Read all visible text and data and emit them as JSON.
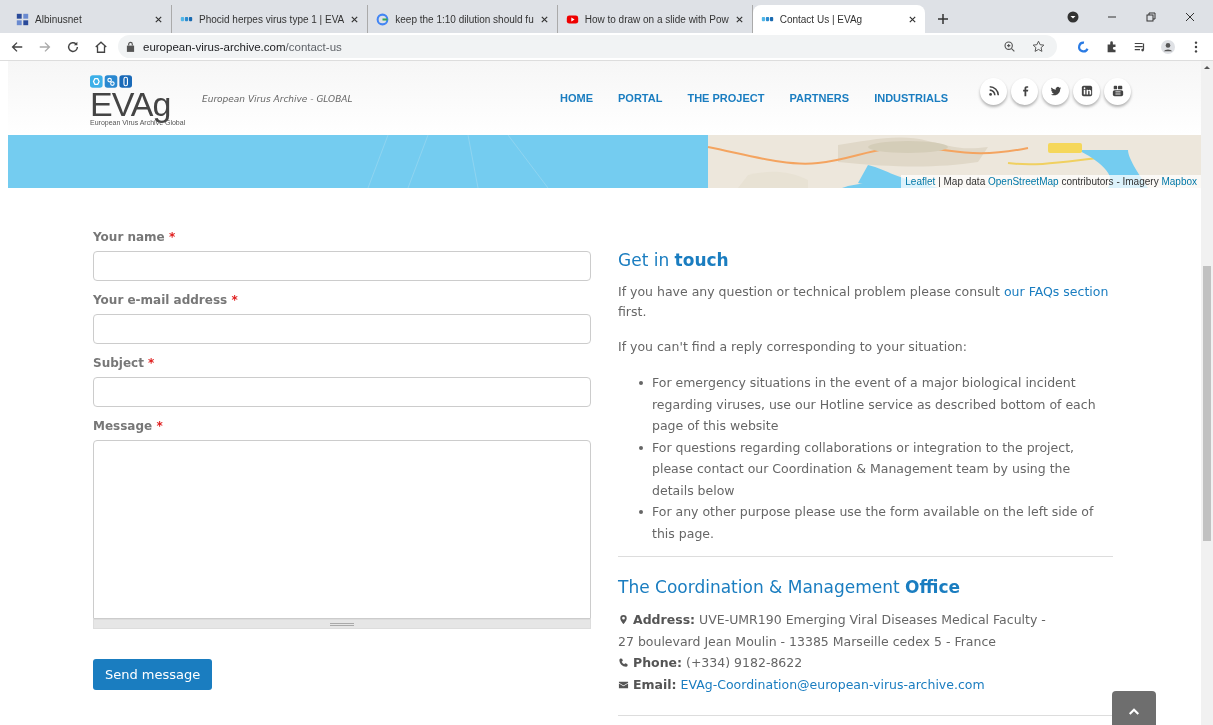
{
  "browser": {
    "tabs": [
      {
        "title": "Albinusnet",
        "kind": "lumc",
        "selected": false
      },
      {
        "title": "Phocid herpes virus type 1 | EVA",
        "kind": "evag",
        "selected": false
      },
      {
        "title": "keep the 1:10 dilution should fu",
        "kind": "google",
        "selected": false
      },
      {
        "title": "How to draw on a slide with Pow",
        "kind": "youtube",
        "selected": false
      },
      {
        "title": "Contact Us | EVAg",
        "kind": "evag",
        "selected": true
      }
    ],
    "url": {
      "domain": "european-virus-archive.com",
      "path": "/contact-us"
    }
  },
  "header": {
    "logo": {
      "mark": "EVAg",
      "subtitle": "European Virus Archive Global",
      "tagline": "European Virus Archive - GLOBAL"
    },
    "nav": [
      {
        "label": "HOME"
      },
      {
        "label": "PORTAL"
      },
      {
        "label": "THE PROJECT"
      },
      {
        "label": "PARTNERS"
      },
      {
        "label": "INDUSTRIALS"
      }
    ],
    "social": [
      {
        "kind": "rss"
      },
      {
        "kind": "facebook"
      },
      {
        "kind": "twitter"
      },
      {
        "kind": "linkedin"
      },
      {
        "kind": "youtube"
      }
    ]
  },
  "map": {
    "attribution": [
      {
        "text": "Leaflet",
        "kind": "link"
      },
      {
        "text": "| Map data",
        "kind": "text"
      },
      {
        "text": "OpenStreetMap",
        "kind": "link"
      },
      {
        "text": "contributors - Imagery",
        "kind": "text"
      },
      {
        "text": "Mapbox",
        "kind": "link"
      }
    ]
  },
  "form": {
    "fields": [
      {
        "label": "Your name",
        "mark": "*",
        "kind": "input"
      },
      {
        "label": "Your e-mail address",
        "mark": "*",
        "kind": "input"
      },
      {
        "label": "Subject",
        "mark": "*",
        "kind": "input"
      },
      {
        "label": "Message",
        "mark": "*",
        "kind": "textarea"
      }
    ],
    "submit": "Send message"
  },
  "contact": {
    "title": "Get in **touch**",
    "intro": {
      "before": "If you have any question or technical problem please consult",
      "link": "our FAQs section",
      "after": "first."
    },
    "lead": "If you can't find a reply corresponding to your situation:",
    "bullets": [
      "For emergency situations in the event of a major biological incident regarding viruses, use our Hotline service as described bottom of each page of this website",
      "For questions regarding collaborations or integration to the project, please contact our Coordination & Management team by using the details below",
      "For any other purpose please use the form available on the left side of this page."
    ],
    "office_title": "The Coordination & Management **Office**",
    "items": [
      {
        "kind": "address",
        "label": "Address:",
        "lines": [
          "UVE-UMR190 Emerging Viral Diseases Medical Faculty -",
          "27 boulevard Jean Moulin - 13385 Marseille cedex 5 - France"
        ]
      },
      {
        "kind": "phone",
        "label": "Phone:",
        "lines": [
          "(+334) 9182-8622"
        ]
      },
      {
        "kind": "email",
        "label": "Email:",
        "link": "EVAg-Coordination@european-virus-archive.com"
      }
    ]
  }
}
